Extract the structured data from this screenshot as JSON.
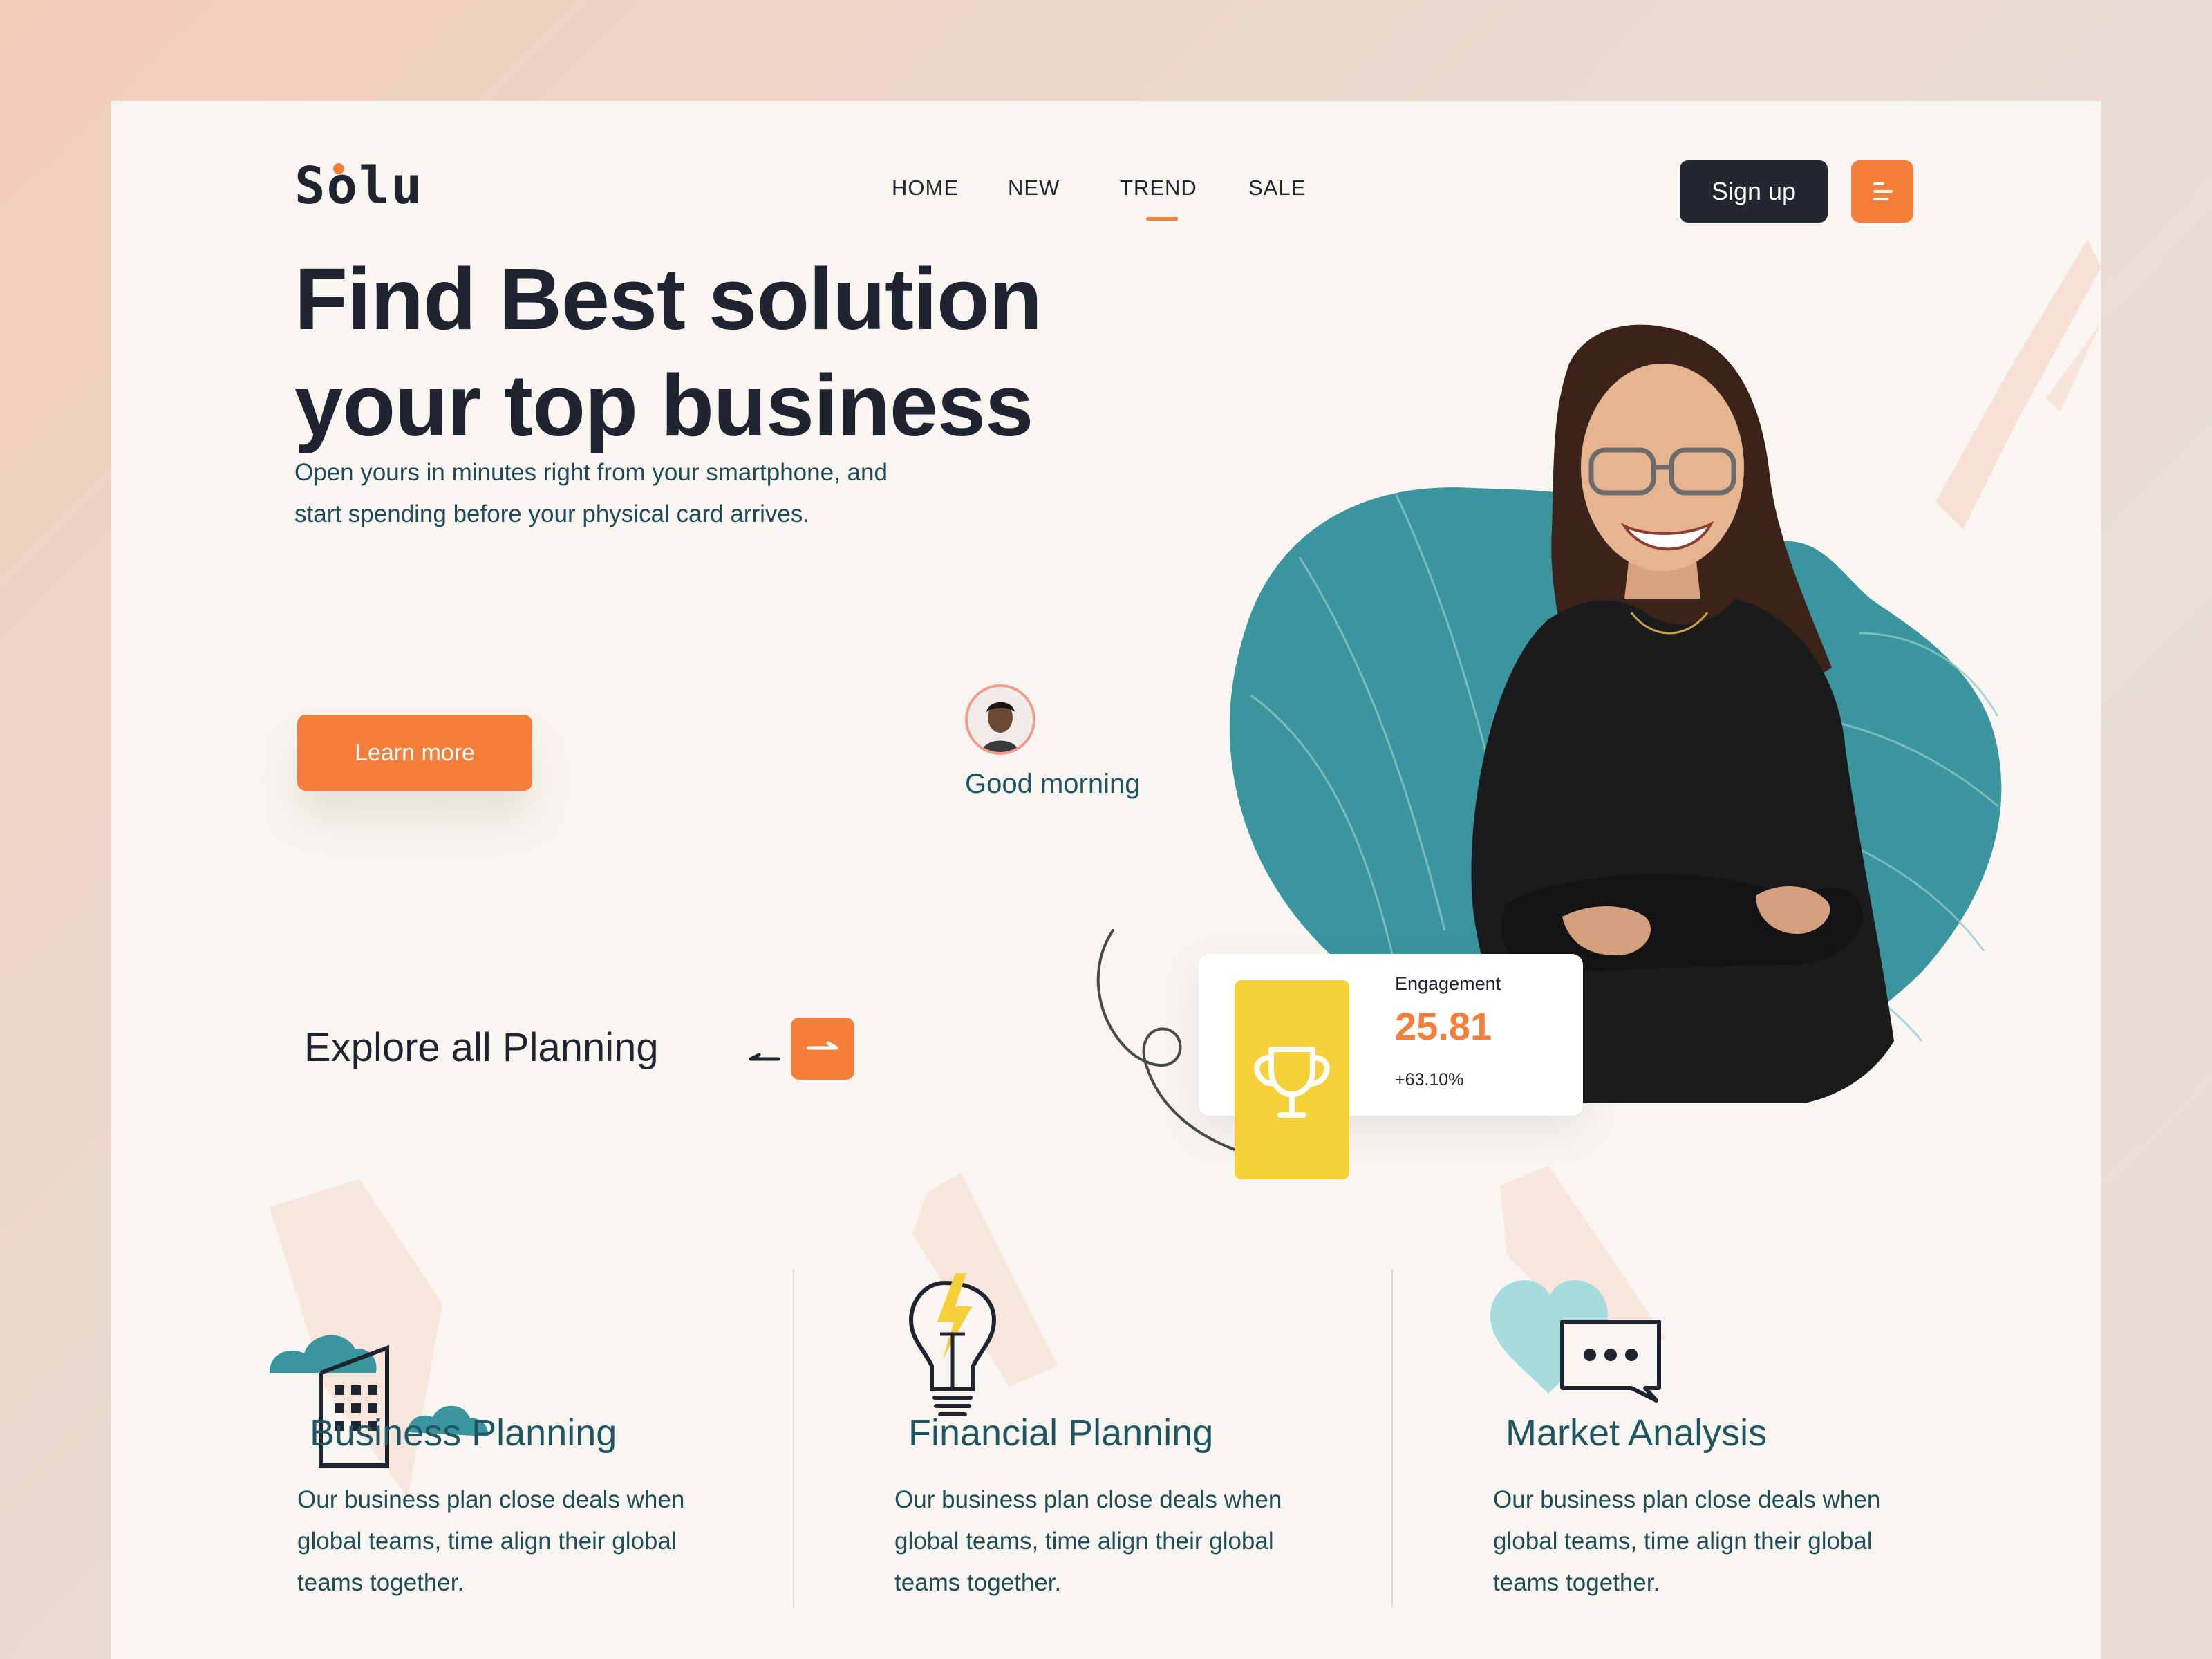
{
  "brand": {
    "name": "Solu"
  },
  "nav": {
    "items": [
      {
        "label": "HOME"
      },
      {
        "label": "NEW"
      },
      {
        "label": "TREND",
        "active": true
      },
      {
        "label": "SALE"
      }
    ],
    "signup_label": "Sign up",
    "menu_icon": "hamburger-menu-icon"
  },
  "hero": {
    "title_line1": "Find Best solution",
    "title_line2": "your top business",
    "subtitle_line1": "Open yours in minutes right from your smartphone, and",
    "subtitle_line2": "start spending before your physical card arrives.",
    "cta_label": "Learn more"
  },
  "greeting": {
    "text": "Good morning"
  },
  "engagement": {
    "label": "Engagement",
    "value": "25.81",
    "change": "+63.10%",
    "icon": "trophy-icon"
  },
  "explore": {
    "title": "Explore all Planning",
    "prev_icon": "arrow-left-icon",
    "next_icon": "arrow-right-icon"
  },
  "features": [
    {
      "title": "Business Planning",
      "desc_line1": "Our business plan close deals when",
      "desc_line2": "global teams, time align their global",
      "desc_line3": "teams together.",
      "icon": "building-clouds-icon"
    },
    {
      "title": "Financial Planning",
      "desc_line1": "Our business plan close deals when",
      "desc_line2": "global teams, time align their global",
      "desc_line3": "teams together.",
      "icon": "lightbulb-icon"
    },
    {
      "title": "Market Analysis",
      "desc_line1": "Our business plan close deals when",
      "desc_line2": "global teams, time align their global",
      "desc_line3": "teams together.",
      "icon": "heart-chat-icon"
    }
  ],
  "colors": {
    "accent": "#f47f3a",
    "teal": "#3a959e",
    "dark": "#23272f",
    "yellow": "#f6d038",
    "heading_teal": "#1e5561"
  }
}
